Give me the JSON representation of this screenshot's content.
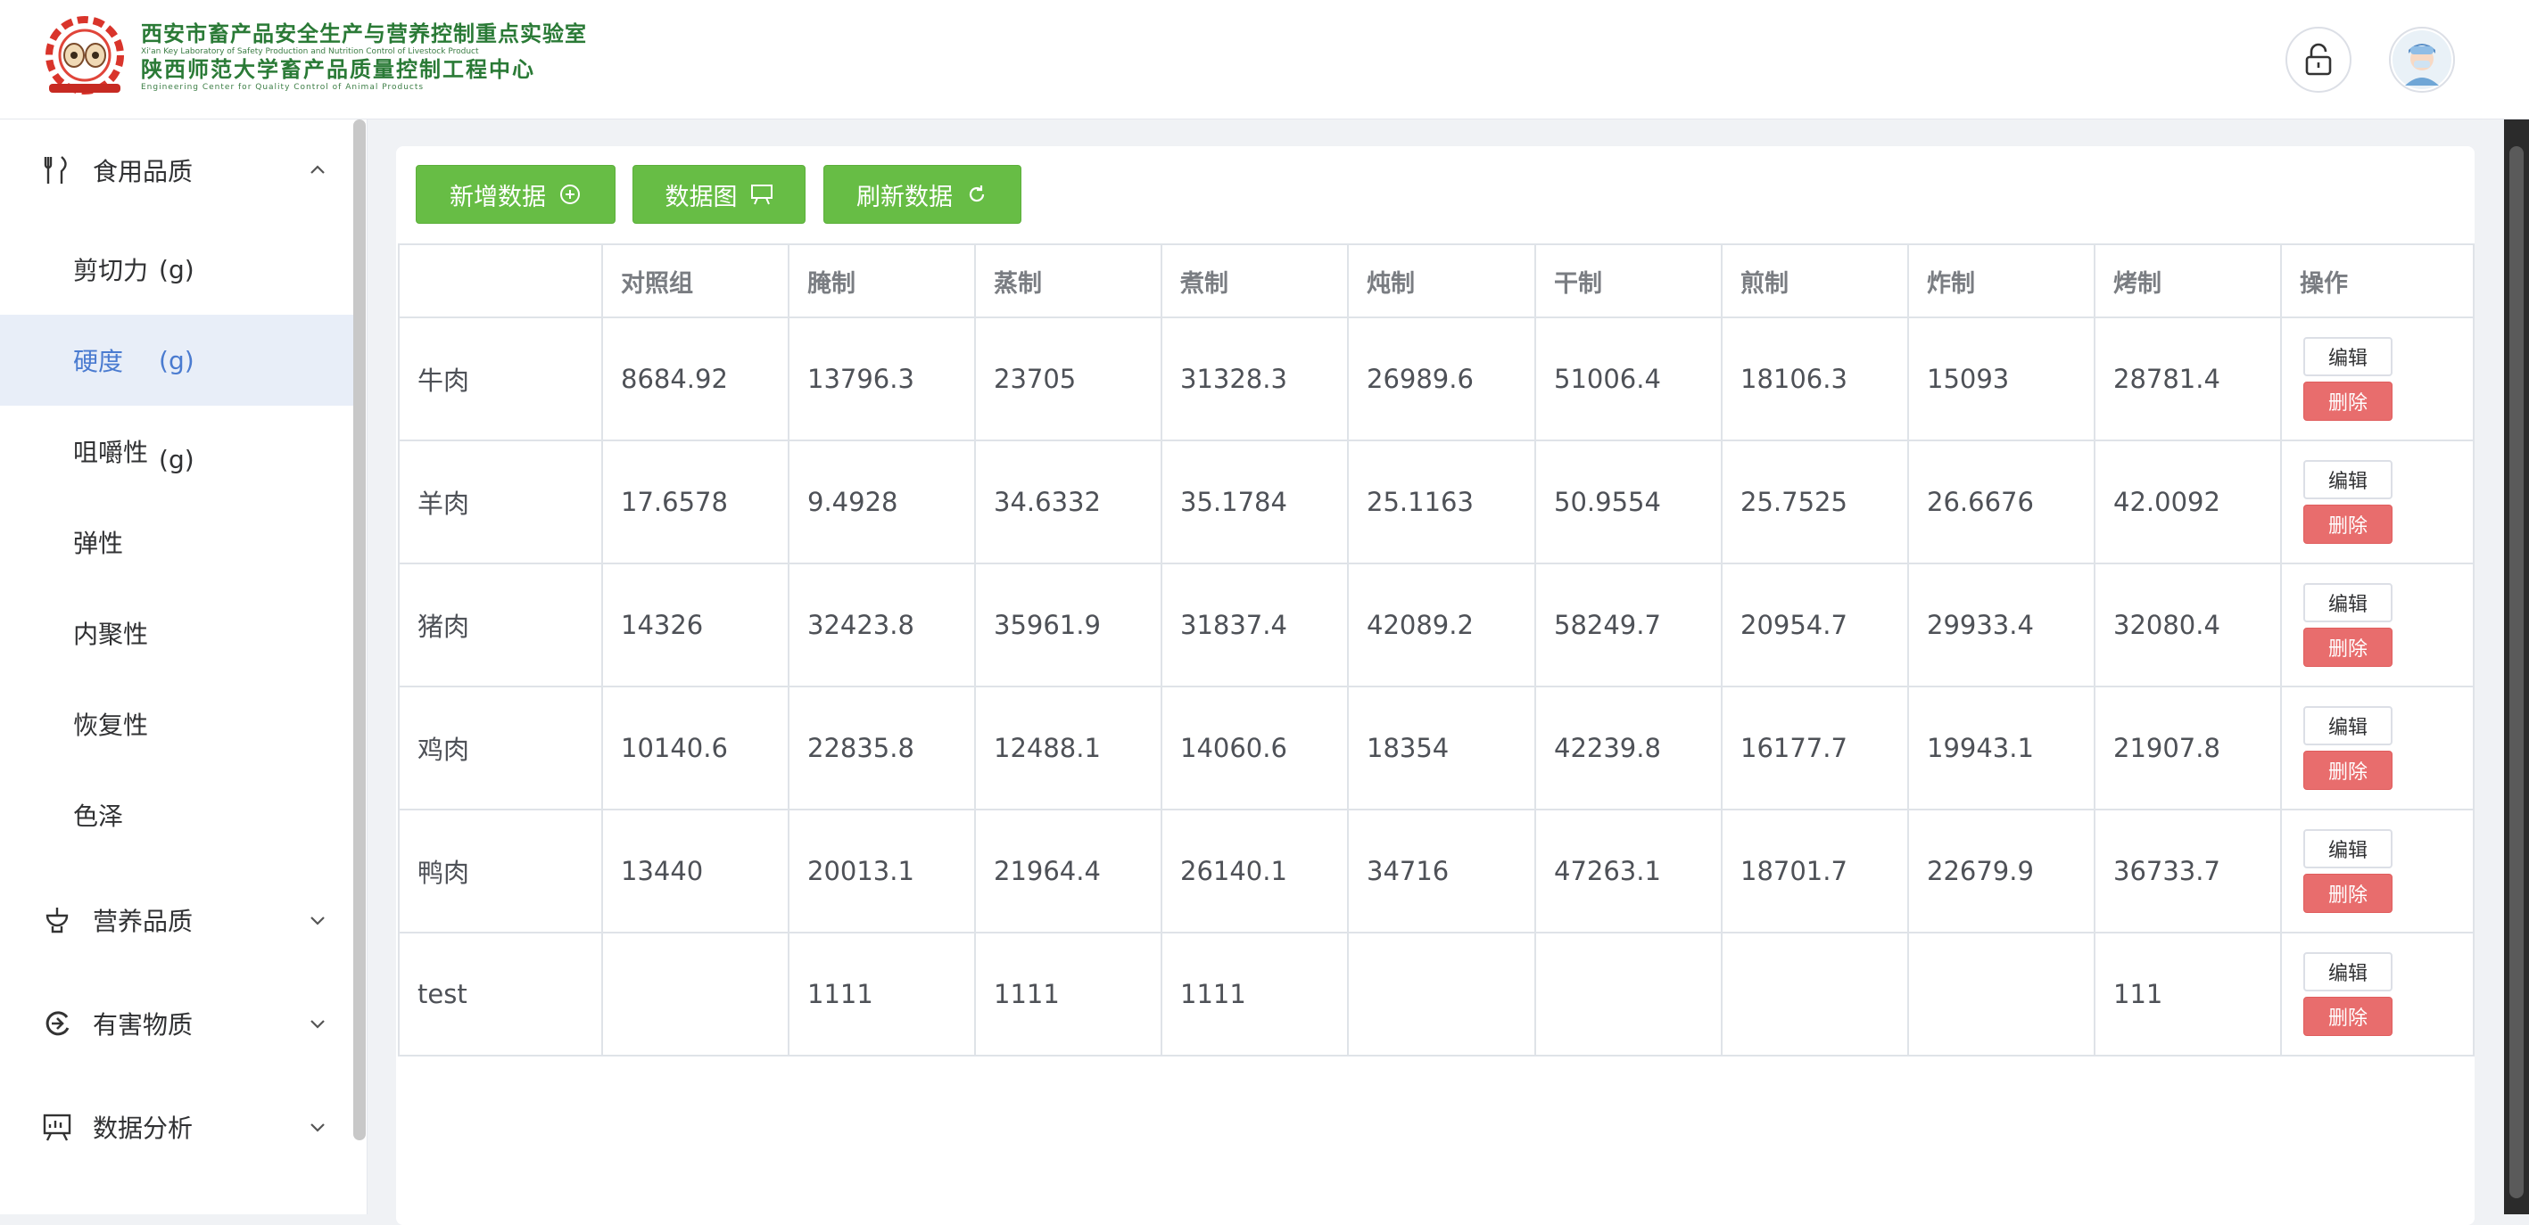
{
  "header": {
    "org_line1": "西安市畜产品安全生产与营养控制重点实验室",
    "org_line2": "Xi'an Key Laboratory of Safety Production and Nutrition Control of Livestock Product",
    "org_line3": "陕西师范大学畜产品质量控制工程中心",
    "org_line4": "Engineering Center for Quality Control of Animal Products"
  },
  "sidebar": {
    "groups": [
      {
        "label": "食用品质",
        "icon": "fork-knife-icon",
        "expanded": true
      },
      {
        "label": "营养品质",
        "icon": "nutrition-icon",
        "expanded": false
      },
      {
        "label": "有害物质",
        "icon": "hazard-icon",
        "expanded": false
      },
      {
        "label": "数据分析",
        "icon": "chart-board-icon",
        "expanded": false
      }
    ],
    "sub_items": [
      {
        "label": "剪切力",
        "unit": "(g)"
      },
      {
        "label": "硬度",
        "unit": "(g)",
        "active": true
      },
      {
        "label": "咀嚼性",
        "unit": "(g)"
      },
      {
        "label": "弹性",
        "unit": ""
      },
      {
        "label": "内聚性",
        "unit": ""
      },
      {
        "label": "恢复性",
        "unit": ""
      },
      {
        "label": "色泽",
        "unit": ""
      }
    ]
  },
  "toolbar": {
    "add_label": "新增数据",
    "chart_label": "数据图",
    "refresh_label": "刷新数据"
  },
  "table": {
    "headers": [
      "",
      "对照组",
      "腌制",
      "蒸制",
      "煮制",
      "炖制",
      "干制",
      "煎制",
      "炸制",
      "烤制",
      "操作"
    ],
    "rows": [
      [
        "牛肉",
        "8684.92",
        "13796.3",
        "23705",
        "31328.3",
        "26989.6",
        "51006.4",
        "18106.3",
        "15093",
        "28781.4"
      ],
      [
        "羊肉",
        "17.6578",
        "9.4928",
        "34.6332",
        "35.1784",
        "25.1163",
        "50.9554",
        "25.7525",
        "26.6676",
        "42.0092"
      ],
      [
        "猪肉",
        "14326",
        "32423.8",
        "35961.9",
        "31837.4",
        "42089.2",
        "58249.7",
        "20954.7",
        "29933.4",
        "32080.4"
      ],
      [
        "鸡肉",
        "10140.6",
        "22835.8",
        "12488.1",
        "14060.6",
        "18354",
        "42239.8",
        "16177.7",
        "19943.1",
        "21907.8"
      ],
      [
        "鸭肉",
        "13440",
        "20013.1",
        "21964.4",
        "26140.1",
        "34716",
        "47263.1",
        "18701.7",
        "22679.9",
        "36733.7"
      ],
      [
        "test",
        "",
        "1111",
        "1111",
        "1111",
        "",
        "",
        "",
        "",
        "111"
      ]
    ],
    "edit_label": "编辑",
    "delete_label": "删除"
  },
  "colors": {
    "primary_green": "#67bd45",
    "danger_red": "#e86d6d",
    "active_bg": "#e8eef8",
    "active_text": "#4a7bd0",
    "brand_green": "#2a7a36"
  }
}
